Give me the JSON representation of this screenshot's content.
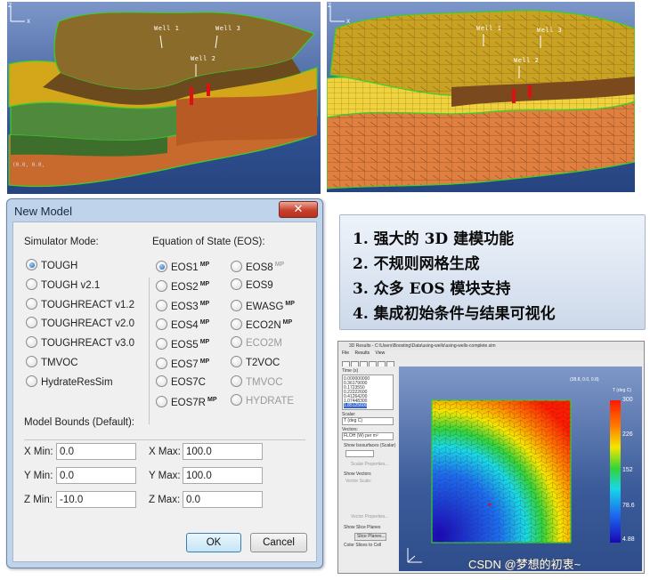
{
  "top_left_view": {
    "wells": [
      "Well 1",
      "Well 3",
      "Well 2"
    ],
    "coord_readout": "(0.0, 0.0,"
  },
  "top_right_view": {
    "wells": [
      "Well 1",
      "Well 3",
      "Well 2"
    ]
  },
  "dialog": {
    "title": "New Model",
    "close_label": "✕",
    "simulator_mode_label": "Simulator Mode:",
    "simulator_modes": [
      {
        "label": "TOUGH",
        "selected": true
      },
      {
        "label": "TOUGH v2.1",
        "selected": false
      },
      {
        "label": "TOUGHREACT v1.2",
        "selected": false
      },
      {
        "label": "TOUGHREACT v2.0",
        "selected": false
      },
      {
        "label": "TOUGHREACT v3.0",
        "selected": false
      },
      {
        "label": "TMVOC",
        "selected": false
      },
      {
        "label": "HydrateResSim",
        "selected": false
      }
    ],
    "eos_label": "Equation of State (EOS):",
    "eos_col1": [
      {
        "label": "EOS1",
        "mp": "MP",
        "selected": true
      },
      {
        "label": "EOS2",
        "mp": "MP"
      },
      {
        "label": "EOS3",
        "mp": "MP"
      },
      {
        "label": "EOS4",
        "mp": "MP"
      },
      {
        "label": "EOS5",
        "mp": "MP"
      },
      {
        "label": "EOS7",
        "mp": "MP"
      },
      {
        "label": "EOS7C",
        "mp": ""
      },
      {
        "label": "EOS7R",
        "mp": "MP"
      }
    ],
    "eos_col2": [
      {
        "label": "EOS8",
        "mp": "MP",
        "disabled_mp": true
      },
      {
        "label": "EOS9",
        "mp": ""
      },
      {
        "label": "EWASG",
        "mp": "MP"
      },
      {
        "label": "ECO2N",
        "mp": "MP"
      },
      {
        "label": "ECO2M",
        "mp": "",
        "disabled": true
      },
      {
        "label": "T2VOC",
        "mp": ""
      },
      {
        "label": "TMVOC",
        "mp": "",
        "disabled": true
      },
      {
        "label": "HYDRATE",
        "mp": "",
        "disabled": true
      }
    ],
    "bounds_label": "Model Bounds (Default):",
    "bounds": {
      "x_min_label": "X Min:",
      "x_min": "0.0",
      "x_max_label": "X Max:",
      "x_max": "100.0",
      "y_min_label": "Y Min:",
      "y_min": "0.0",
      "y_max_label": "Y Max:",
      "y_max": "100.0",
      "z_min_label": "Z Min:",
      "z_min": "-10.0",
      "z_max_label": "Z Max:",
      "z_max": "0.0"
    },
    "ok_label": "OK",
    "cancel_label": "Cancel"
  },
  "features": [
    "1.  强大的 3D 建模功能",
    "2.  不规则网格生成",
    "3.  众多 EOS 模块支持",
    "4.  集成初始条件与结果可视化"
  ],
  "results_window": {
    "title": "3D Results - C:\\Users\\Boosting\\Data\\using-wells\\using-wells-complete.sim",
    "menu": [
      "File",
      "Results",
      "View"
    ],
    "time_label": "Time (s)",
    "times": [
      "0.000000000",
      "0.36179000",
      "0.1723550",
      "0.22222600",
      "0.41264200",
      "1.07448300",
      "1.85125600"
    ],
    "scalar_label": "Scalar:",
    "scalar_value": "T (deg C)",
    "vectors_label": "Vectors:",
    "vectors_value": "FLOH (W) per m²",
    "show_isosurfaces": "Show Isosurfaces (Scalar)",
    "scalar_properties": "Scalar Properties...",
    "show_vectors": "Show Vectors",
    "vector_scale": "Vector Scale:",
    "vector_properties": "Vector Properties...",
    "show_slice_planes": "Show Slice Planes",
    "slice_planes_btn": "Slice Planes...",
    "color_slices": "Color Slices to Cell",
    "coord_readout": "(38.8, 0.0, 0.8)",
    "colorbar_title": "T (deg C)",
    "colorbar_ticks": [
      "300",
      "226",
      "152",
      "78.6",
      "4.88"
    ]
  },
  "watermark": "CSDN @梦想的初衷~"
}
